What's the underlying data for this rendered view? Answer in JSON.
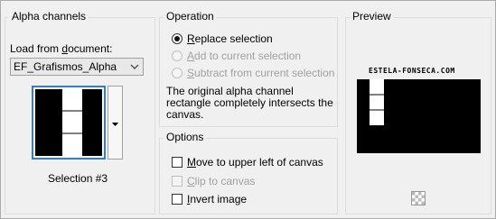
{
  "alpha_channels": {
    "title": "Alpha channels",
    "load_label_pre": "Load from ",
    "load_label_u": "d",
    "load_label_post": "ocument:",
    "document_value": "EF_Grafismos_Alpha",
    "selection_label": "Selection #3"
  },
  "operation": {
    "title": "Operation",
    "options": [
      {
        "u": "R",
        "rest": "eplace selection",
        "selected": true,
        "enabled": true
      },
      {
        "u": "A",
        "rest": "dd to current selection",
        "selected": false,
        "enabled": false
      },
      {
        "u": "S",
        "rest": "ubtract from current selection",
        "selected": false,
        "enabled": false
      }
    ],
    "description": "The original alpha channel rectangle completely intersects the canvas."
  },
  "options": {
    "title": "Options",
    "items": [
      {
        "u": "M",
        "rest": "ove to upper left of canvas",
        "checked": false,
        "enabled": true
      },
      {
        "u": "C",
        "rest": "lip to canvas",
        "checked": false,
        "enabled": false
      },
      {
        "u": "I",
        "rest": "nvert image",
        "checked": false,
        "enabled": true
      }
    ]
  },
  "preview": {
    "title": "Preview",
    "watermark": "ESTELA-FONSECA.COM"
  },
  "icons": {
    "dropdown": "chevron-down-icon",
    "thumb_dropdown": "triangle-down-icon",
    "checker": "transparency-checker-icon"
  }
}
